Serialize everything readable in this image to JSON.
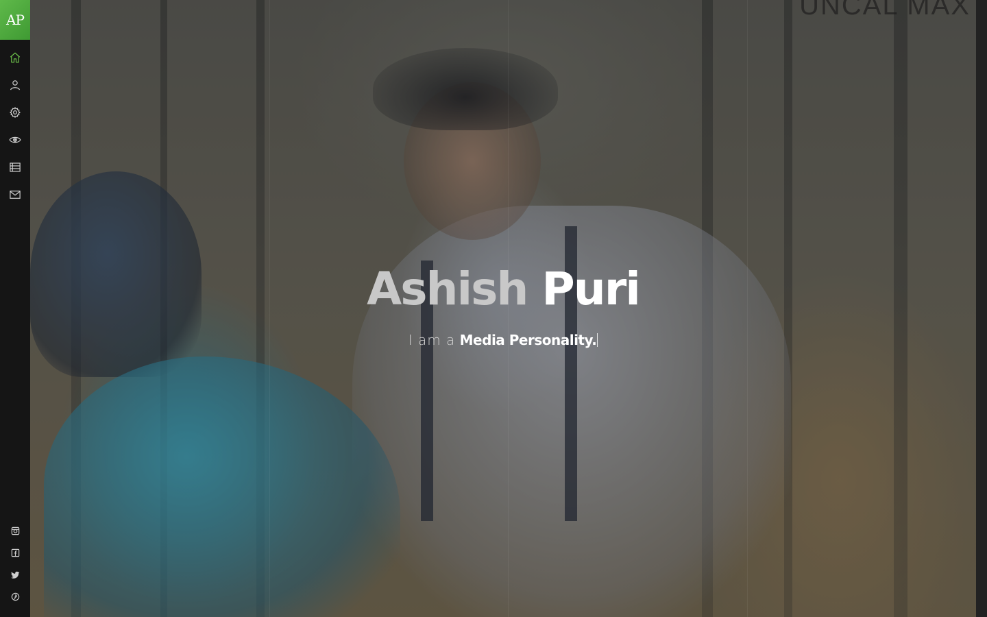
{
  "brand": {
    "logo_text": "AP"
  },
  "nav": {
    "items": [
      {
        "icon": "home-icon",
        "label": "Home",
        "active": true
      },
      {
        "icon": "user-icon",
        "label": "About"
      },
      {
        "icon": "gear-icon",
        "label": "Services"
      },
      {
        "icon": "eye-icon",
        "label": "Portfolio"
      },
      {
        "icon": "list-icon",
        "label": "Blog"
      },
      {
        "icon": "mail-icon",
        "label": "Contact"
      }
    ]
  },
  "social": [
    {
      "icon": "instagram-icon"
    },
    {
      "icon": "facebook-icon"
    },
    {
      "icon": "twitter-icon"
    },
    {
      "icon": "pinterest-icon"
    }
  ],
  "hero": {
    "watermark": "UNCAL MAX",
    "first_name": "Ashish",
    "last_name": "Puri",
    "prefix": "I am a",
    "role": "Media Personality."
  },
  "colors": {
    "accent": "#5fb94a",
    "sidebar_bg": "#151515",
    "icon": "#cfcfcf",
    "active_icon": "#6cc04a"
  }
}
